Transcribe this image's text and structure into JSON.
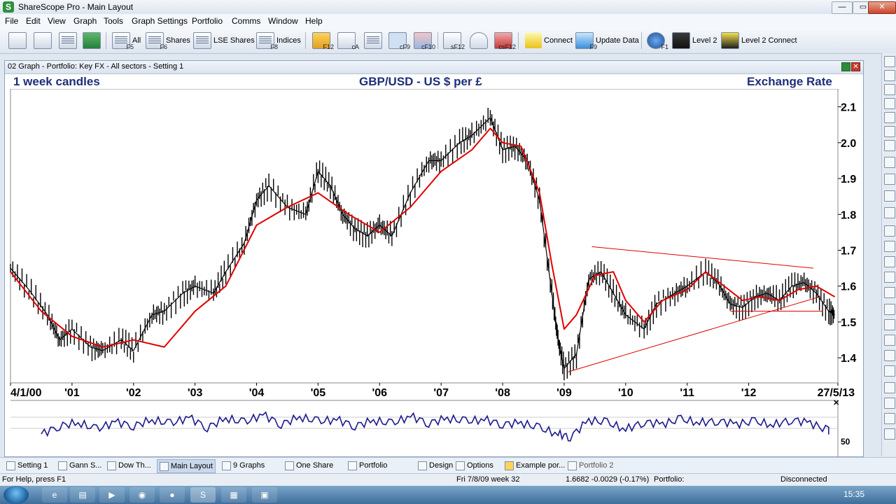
{
  "window": {
    "title": "ShareScope Pro - Main Layout",
    "app_icon": "S",
    "minimize": "—",
    "maximize": "▭",
    "close": "✕"
  },
  "menu": [
    "File",
    "Edit",
    "View",
    "Graph",
    "Tools",
    "Graph Settings",
    "Portfolio",
    "Comms",
    "Window",
    "Help"
  ],
  "toolbar": {
    "all": "All",
    "all_key": "F5",
    "shares": "Shares",
    "shares_key": "F6",
    "lse_shares": "LSE Shares",
    "indices": "Indices",
    "indices_key": "F8",
    "key_f12": "F12",
    "key_ca": "cA",
    "key_cf9": "cF9",
    "key_cf10": "cF10",
    "key_sf12": "sF12",
    "key_csf12": "csF12",
    "connect": "Connect",
    "update_data": "Update Data",
    "update_key": "F9",
    "help_key": "F1",
    "level2": "Level 2",
    "level2_connect": "Level 2 Connect"
  },
  "graph": {
    "window_title": "02 Graph - Portfolio: Key FX - All sectors - Setting 1",
    "candles_label": "1 week candles",
    "instrument": "GBP/USD - US $ per £",
    "measure": "Exchange Rate",
    "indicator_level": "50",
    "close_indicator": "✕"
  },
  "chart_data": {
    "type": "line",
    "title": "GBP/USD - US $ per £",
    "xlabel": "",
    "ylabel": "Exchange Rate",
    "x_tick_labels": [
      "4/1/00",
      "'01",
      "'02",
      "'03",
      "'04",
      "'05",
      "'06",
      "'07",
      "'08",
      "'09",
      "'10",
      "'11",
      "'12",
      "27/5/13"
    ],
    "y_tick_labels": [
      "1.4",
      "1.5",
      "1.6",
      "1.7",
      "1.8",
      "1.9",
      "2.0",
      "2.1"
    ],
    "ylim": [
      1.33,
      2.15
    ],
    "xlim": [
      2000.0,
      2013.45
    ],
    "series": [
      {
        "color": "#000000",
        "x": [
          2000.0,
          2000.3,
          2000.6,
          2000.8,
          2001.0,
          2001.3,
          2001.5,
          2001.8,
          2002.0,
          2002.3,
          2002.5,
          2002.8,
          2003.0,
          2003.3,
          2003.5,
          2003.8,
          2004.0,
          2004.2,
          2004.5,
          2004.8,
          2005.0,
          2005.2,
          2005.4,
          2005.6,
          2005.8,
          2006.0,
          2006.2,
          2006.5,
          2006.8,
          2007.0,
          2007.3,
          2007.5,
          2007.8,
          2008.0,
          2008.2,
          2008.4,
          2008.6,
          2008.8,
          2008.9,
          2009.0,
          2009.2,
          2009.4,
          2009.6,
          2009.8,
          2010.0,
          2010.3,
          2010.5,
          2010.8,
          2011.0,
          2011.3,
          2011.5,
          2011.7,
          2011.9,
          2012.1,
          2012.3,
          2012.5,
          2012.7,
          2012.9,
          2013.1,
          2013.3,
          2013.4
        ],
        "y": [
          1.65,
          1.59,
          1.52,
          1.45,
          1.48,
          1.43,
          1.42,
          1.45,
          1.42,
          1.52,
          1.53,
          1.58,
          1.6,
          1.58,
          1.64,
          1.72,
          1.84,
          1.88,
          1.82,
          1.8,
          1.92,
          1.88,
          1.8,
          1.76,
          1.74,
          1.77,
          1.74,
          1.86,
          1.95,
          1.95,
          2.0,
          2.02,
          2.07,
          1.98,
          1.99,
          1.95,
          1.84,
          1.58,
          1.45,
          1.37,
          1.41,
          1.62,
          1.64,
          1.58,
          1.52,
          1.48,
          1.55,
          1.58,
          1.6,
          1.64,
          1.61,
          1.55,
          1.54,
          1.57,
          1.58,
          1.56,
          1.6,
          1.61,
          1.58,
          1.53,
          1.52
        ]
      },
      {
        "color": "#e00000",
        "x": [
          2000.0,
          2000.5,
          2001.0,
          2001.5,
          2002.0,
          2002.5,
          2003.0,
          2003.5,
          2004.0,
          2004.5,
          2005.0,
          2005.5,
          2006.0,
          2006.5,
          2007.0,
          2007.5,
          2007.8,
          2008.0,
          2008.3,
          2008.6,
          2008.8,
          2009.0,
          2009.2,
          2009.5,
          2009.8,
          2010.0,
          2010.3,
          2010.6,
          2011.0,
          2011.3,
          2011.6,
          2011.9,
          2012.2,
          2012.5,
          2012.8,
          2013.1,
          2013.4
        ],
        "y": [
          1.64,
          1.53,
          1.46,
          1.43,
          1.45,
          1.43,
          1.53,
          1.6,
          1.77,
          1.82,
          1.86,
          1.8,
          1.75,
          1.82,
          1.92,
          1.98,
          2.04,
          2.0,
          1.99,
          1.86,
          1.66,
          1.48,
          1.52,
          1.63,
          1.64,
          1.56,
          1.5,
          1.56,
          1.59,
          1.64,
          1.6,
          1.56,
          1.57,
          1.56,
          1.59,
          1.6,
          1.57
        ]
      }
    ],
    "trendlines": [
      {
        "x": [
          2009.05,
          2013.15
        ],
        "y": [
          1.36,
          1.57
        ]
      },
      {
        "x": [
          2009.45,
          2013.05
        ],
        "y": [
          1.71,
          1.65
        ]
      },
      {
        "x": [
          2011.7,
          2013.2
        ],
        "y": [
          1.53,
          1.53
        ]
      }
    ],
    "indicator": {
      "level": 50,
      "x": [
        2000.5,
        2000.8,
        2001.1,
        2001.4,
        2001.7,
        2002.0,
        2002.3,
        2002.6,
        2002.9,
        2003.2,
        2003.5,
        2003.8,
        2004.1,
        2004.4,
        2004.7,
        2005.0,
        2005.3,
        2005.6,
        2005.9,
        2006.2,
        2006.5,
        2006.8,
        2007.1,
        2007.4,
        2007.7,
        2008.0,
        2008.3,
        2008.6,
        2008.9,
        2009.1,
        2009.4,
        2009.7,
        2010.0,
        2010.3,
        2010.6,
        2010.9,
        2011.2,
        2011.5,
        2011.8,
        2012.1,
        2012.4,
        2012.7,
        2013.0,
        2013.3
      ],
      "y": [
        40,
        55,
        60,
        48,
        62,
        55,
        65,
        58,
        70,
        52,
        68,
        60,
        75,
        58,
        70,
        62,
        66,
        55,
        64,
        58,
        72,
        60,
        68,
        62,
        66,
        58,
        60,
        50,
        40,
        35,
        65,
        60,
        48,
        62,
        58,
        66,
        60,
        64,
        58,
        62,
        56,
        66,
        60,
        45
      ]
    }
  },
  "tabs": [
    {
      "key": "F2",
      "label": "Setting 1",
      "active": false
    },
    {
      "key": "F3",
      "label": "Gann S...",
      "active": false
    },
    {
      "key": "F4",
      "label": "Dow Th...",
      "active": false
    },
    {
      "key": "",
      "label": "Main Layout",
      "active": true
    },
    {
      "key": "",
      "label": "9 Graphs",
      "active": false
    },
    {
      "key": "",
      "label": "One Share",
      "active": false
    },
    {
      "key": "",
      "label": "Portfolio",
      "active": false
    },
    {
      "key": "",
      "label": "Design",
      "active": false
    },
    {
      "key": "",
      "label": "Options",
      "active": false
    },
    {
      "key": "",
      "label": "Example por...",
      "active": false
    },
    {
      "key": "",
      "label": "Portfolio 2",
      "active": false
    }
  ],
  "status": {
    "help": "For Help, press F1",
    "date": "Fri 7/8/09  week 32",
    "quote": "1.6682  -0.0029  (-0.17%)",
    "portfolio": "Portfolio:",
    "connection": "Disconnected"
  },
  "taskbar": {
    "clock": "15:35"
  }
}
